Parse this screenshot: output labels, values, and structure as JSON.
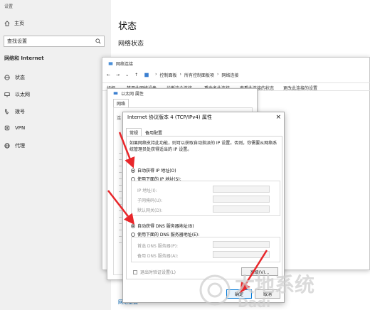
{
  "settings": {
    "app_title": "设置",
    "home_label": "主页",
    "search_placeholder": "查找设置",
    "section_title": "网络和 Internet",
    "nav": [
      {
        "label": "状态",
        "icon": "status-icon"
      },
      {
        "label": "以太网",
        "icon": "ethernet-icon"
      },
      {
        "label": "拨号",
        "icon": "dialup-icon"
      },
      {
        "label": "VPN",
        "icon": "vpn-icon"
      },
      {
        "label": "代理",
        "icon": "proxy-icon"
      }
    ],
    "main_title": "状态",
    "main_subtitle": "网络状态",
    "bottom_link": "网络重置"
  },
  "network_window": {
    "title": "网络连接",
    "breadcrumb": [
      "控制面板",
      "所有控制面板项",
      "网络连接"
    ],
    "toolbar": [
      "组织",
      "禁用此网络设备",
      "诊断这个连接",
      "重命名此连接",
      "查看此连接的状态",
      "更改此连接的设置"
    ]
  },
  "ethernet_dialog": {
    "title": "以太网 属性",
    "tab": "网络",
    "edge_text": "连"
  },
  "ipv4_dialog": {
    "title": "Internet 协议版本 4 (TCP/IPv4) 属性",
    "close_glyph": "×",
    "tabs": [
      "常规",
      "备用配置"
    ],
    "description": "如果网络支持此功能，则可以获取自动指派的 IP 设置。否则，你需要从网络系统管理员处获得适当的 IP 设置。",
    "radio_auto_ip": "自动获得 IP 地址(O)",
    "radio_manual_ip": "使用下面的 IP 地址(S):",
    "ip_fields": [
      "IP 地址(I):",
      "子网掩码(U):",
      "默认网关(D):"
    ],
    "radio_auto_dns": "自动获得 DNS 服务器地址(B)",
    "radio_manual_dns": "使用下面的 DNS 服务器地址(E):",
    "dns_fields": [
      "首选 DNS 服务器(P):",
      "备用 DNS 服务器(A):"
    ],
    "validate_checkbox": "退出时验证设置(L)",
    "advanced_button": "高级(V)...",
    "ok_button": "确定",
    "cancel_button": "取消"
  },
  "watermark": {
    "text": "大地系统",
    "subtext": "Dadi"
  },
  "colors": {
    "accent": "#0078d7",
    "arrow": "#e8262a",
    "sidebar_bg": "#f0f0f0"
  }
}
